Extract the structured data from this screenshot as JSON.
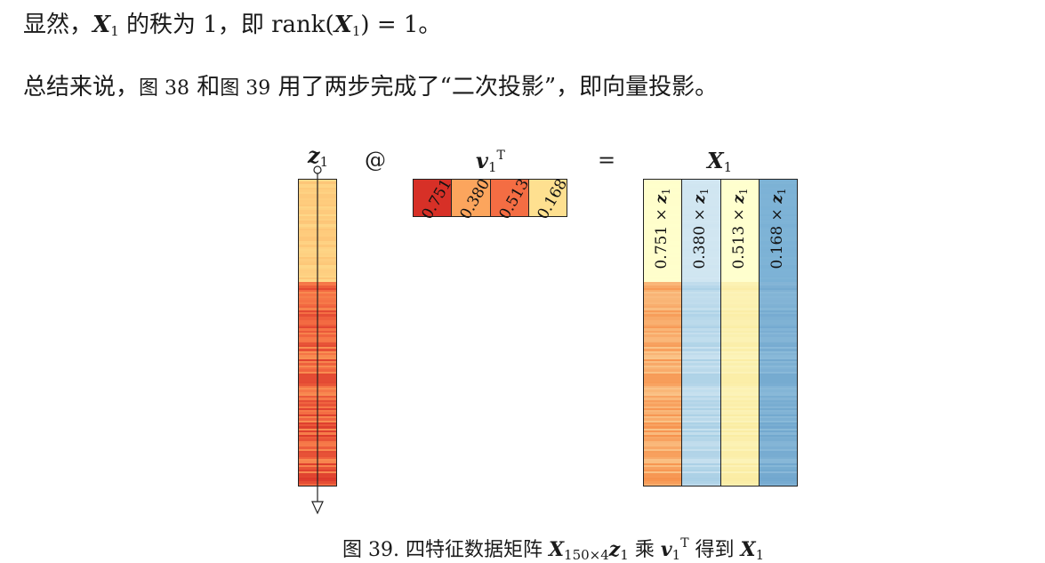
{
  "text": {
    "line1_a": "显然，",
    "line1_var": "X",
    "line1_sub": "1",
    "line1_b": " 的秩为 1，即 rank(",
    "line1_c": ") = 1。",
    "line2_a": "总结来说，",
    "line2_fig1": "图 38",
    "line2_b": " 和",
    "line2_fig2": "图 39",
    "line2_c": " 用了两步完成了“二次投影”，即向量投影。"
  },
  "figure": {
    "z_label": "z",
    "z_sub": "1",
    "at_symbol": "@",
    "v_label": "v",
    "v_sub": "1",
    "v_sup": "T",
    "equals": "=",
    "x_label": "X",
    "x_sub": "1",
    "v_values": [
      "0.751",
      "0.380",
      "0.513",
      "0.168"
    ],
    "v_colors": [
      "#d73027",
      "#fca55d",
      "#f46d43",
      "#fee090"
    ],
    "x_cols": [
      {
        "coef": "0.751 × ",
        "var": "z",
        "sub": "1"
      },
      {
        "coef": "0.380 × ",
        "var": "z",
        "sub": "1"
      },
      {
        "coef": "0.513 × ",
        "var": "z",
        "sub": "1"
      },
      {
        "coef": "0.168 × ",
        "var": "z",
        "sub": "1"
      }
    ]
  },
  "caption": {
    "a": "图 39. 四特征数据矩阵 ",
    "var": "X",
    "sub": "150×4",
    "var2": "z",
    "sub2": "1",
    "b": " 乘 ",
    "var3": "v",
    "sub3": "1",
    "sup3": "T",
    "c": " 得到 ",
    "var4": "X",
    "sub4": "1"
  }
}
